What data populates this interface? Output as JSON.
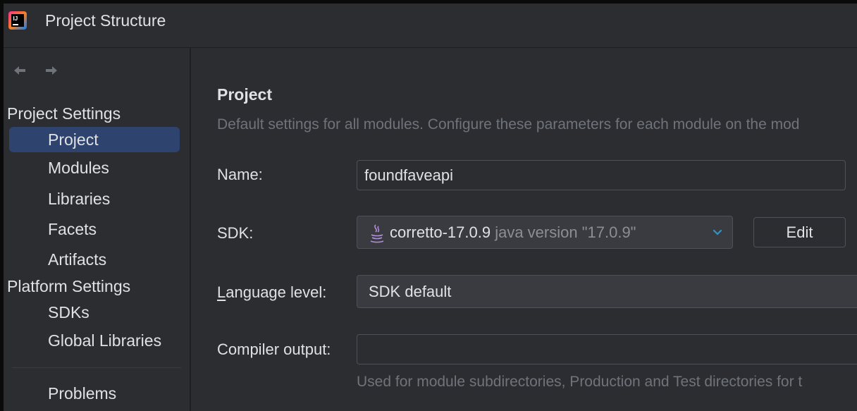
{
  "window": {
    "title": "Project Structure"
  },
  "sidebar": {
    "project_settings_title": "Project Settings",
    "project_items": [
      "Project",
      "Modules",
      "Libraries",
      "Facets",
      "Artifacts"
    ],
    "platform_settings_title": "Platform Settings",
    "platform_items": [
      "SDKs",
      "Global Libraries"
    ],
    "problems": "Problems",
    "selected": "Project"
  },
  "content": {
    "title": "Project",
    "description": "Default settings for all modules. Configure these parameters for each module on the mod",
    "name_label": "Name:",
    "name_value": "foundfaveapi",
    "sdk_label": "SDK:",
    "sdk_name": "corretto-17.0.9",
    "sdk_version": "java version \"17.0.9\"",
    "edit_button": "Edit",
    "language_level_label_mnemonic": "L",
    "language_level_label_rest": "anguage level:",
    "language_level_value": "SDK default",
    "compiler_output_label": "Compiler output:",
    "compiler_output_value": "",
    "compiler_output_hint": "Used for module subdirectories, Production and Test directories for t"
  },
  "icons": {
    "app": "intellij-logo-icon",
    "back": "arrow-left-icon",
    "forward": "arrow-right-icon",
    "sdk": "java-duke-icon",
    "dropdown": "chevron-down-icon"
  },
  "colors": {
    "background": "#2b2d30",
    "selection": "#2e436e",
    "accent": "#3574f0",
    "muted_text": "#6f737a"
  }
}
